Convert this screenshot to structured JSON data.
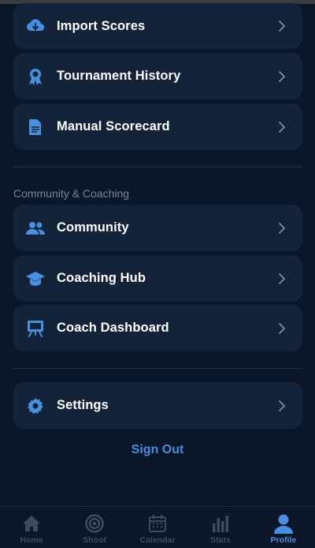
{
  "menu": {
    "items_top": [
      {
        "label": "Import Scores",
        "icon": "cloud-download-icon"
      },
      {
        "label": "Tournament History",
        "icon": "award-ribbon-icon"
      },
      {
        "label": "Manual Scorecard",
        "icon": "document-icon"
      }
    ],
    "section_title": "Community & Coaching",
    "items_community": [
      {
        "label": "Community",
        "icon": "people-icon"
      },
      {
        "label": "Coaching Hub",
        "icon": "graduation-cap-icon"
      },
      {
        "label": "Coach Dashboard",
        "icon": "easel-icon"
      }
    ],
    "settings": {
      "label": "Settings",
      "icon": "gear-icon"
    },
    "sign_out": "Sign Out"
  },
  "tabbar": {
    "tabs": [
      {
        "label": "Home",
        "icon": "home-icon"
      },
      {
        "label": "Shoot",
        "icon": "target-icon"
      },
      {
        "label": "Calendar",
        "icon": "calendar-icon"
      },
      {
        "label": "Stats",
        "icon": "bar-chart-icon"
      },
      {
        "label": "Profile",
        "icon": "person-icon"
      }
    ],
    "active": "Profile"
  },
  "colors": {
    "background": "#0b1628",
    "card": "#13233a",
    "accent": "#4a8ee0",
    "muted": "#6f86a3",
    "inactive_tab": "#3d4b60"
  }
}
